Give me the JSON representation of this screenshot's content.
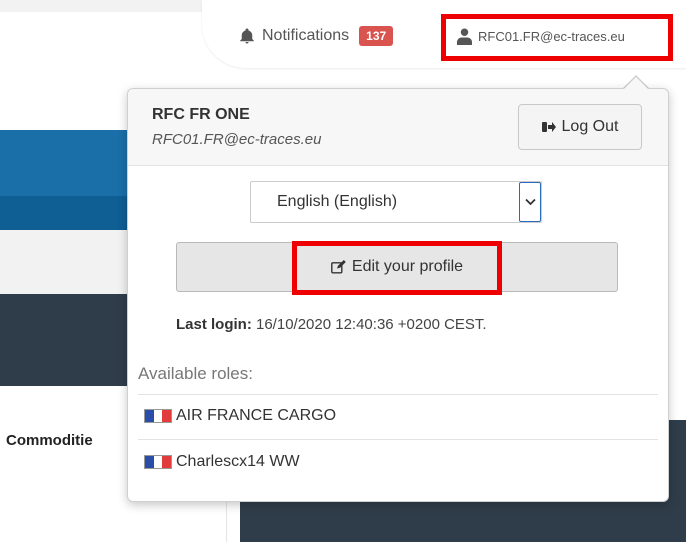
{
  "header": {
    "notifications_label": "Notifications",
    "notifications_count": "137",
    "user_email": "RFC01.FR@ec-traces.eu"
  },
  "background": {
    "commodities_label": "Commoditie"
  },
  "profile": {
    "name": "RFC FR ONE",
    "email": "RFC01.FR@ec-traces.eu",
    "logout_label": "Log Out",
    "language_value": "English (English)",
    "edit_profile_label": "Edit your profile",
    "last_login_label": "Last login:",
    "last_login_value": "16/10/2020 12:40:36 +0200 CEST.",
    "roles_title": "Available roles:",
    "roles": [
      {
        "label": "AIR FRANCE CARGO",
        "flag": "flag-france-icon"
      },
      {
        "label": "Charlescx14 WW",
        "flag": "flag-france-icon"
      }
    ]
  },
  "colors": {
    "highlight": "#ee0000",
    "badge": "#d9534f",
    "header_blue": "#1a6fa8",
    "dark_panel": "#2f3d4a",
    "flag_blue": "#2a4ea8",
    "flag_red": "#e23b3b"
  }
}
